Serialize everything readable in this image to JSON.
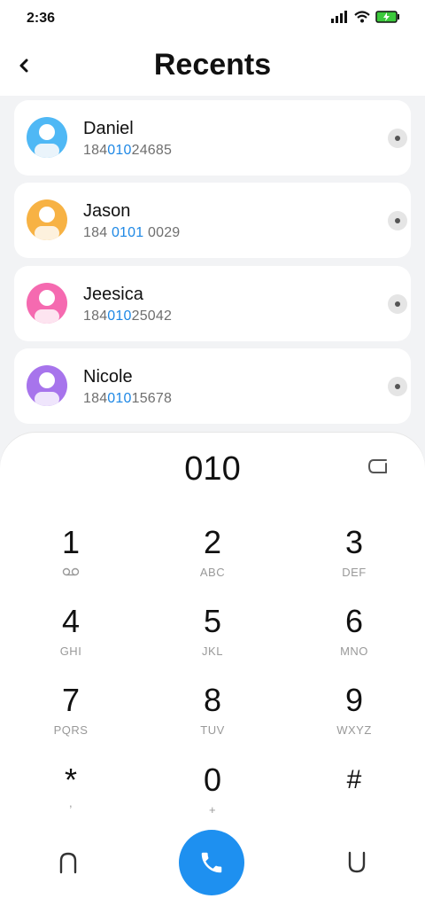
{
  "status": {
    "time": "2:36"
  },
  "header": {
    "title": "Recents"
  },
  "contacts": [
    {
      "name": "Daniel",
      "number_pre": "184",
      "number_hl": "010",
      "number_post": "24685",
      "color": "#4fb8f5"
    },
    {
      "name": "Jason",
      "number_pre": "184 ",
      "number_hl": "0101",
      "number_post": " 0029",
      "color": "#f7b244"
    },
    {
      "name": "Jeesica",
      "number_pre": "184",
      "number_hl": "010",
      "number_post": "25042",
      "color": "#f56ab0"
    },
    {
      "name": "Nicole",
      "number_pre": "184",
      "number_hl": "010",
      "number_post": "15678",
      "color": "#a774ec"
    }
  ],
  "dialpad": {
    "display": "010",
    "keys": [
      {
        "digit": "1",
        "letters": ""
      },
      {
        "digit": "2",
        "letters": "ABC"
      },
      {
        "digit": "3",
        "letters": "DEF"
      },
      {
        "digit": "4",
        "letters": "GHI"
      },
      {
        "digit": "5",
        "letters": "JKL"
      },
      {
        "digit": "6",
        "letters": "MNO"
      },
      {
        "digit": "7",
        "letters": "PQRS"
      },
      {
        "digit": "8",
        "letters": "TUV"
      },
      {
        "digit": "9",
        "letters": "WXYZ"
      },
      {
        "digit": "*",
        "letters": ","
      },
      {
        "digit": "0",
        "letters": "+"
      },
      {
        "digit": "#",
        "letters": ""
      }
    ]
  },
  "icons": {
    "back": "chevron-left-icon",
    "signal": "signal-icon",
    "wifi": "wifi-icon",
    "battery": "battery-charging-icon",
    "more": "more-icon",
    "delete": "backspace-icon",
    "voicemail": "voicemail-icon",
    "call": "phone-icon",
    "collapse_left": "collapse-icon",
    "collapse_right": "expand-icon"
  },
  "colors": {
    "accent": "#1e88e5",
    "call_button": "#1e90f0",
    "battery_green": "#3cc93c"
  }
}
